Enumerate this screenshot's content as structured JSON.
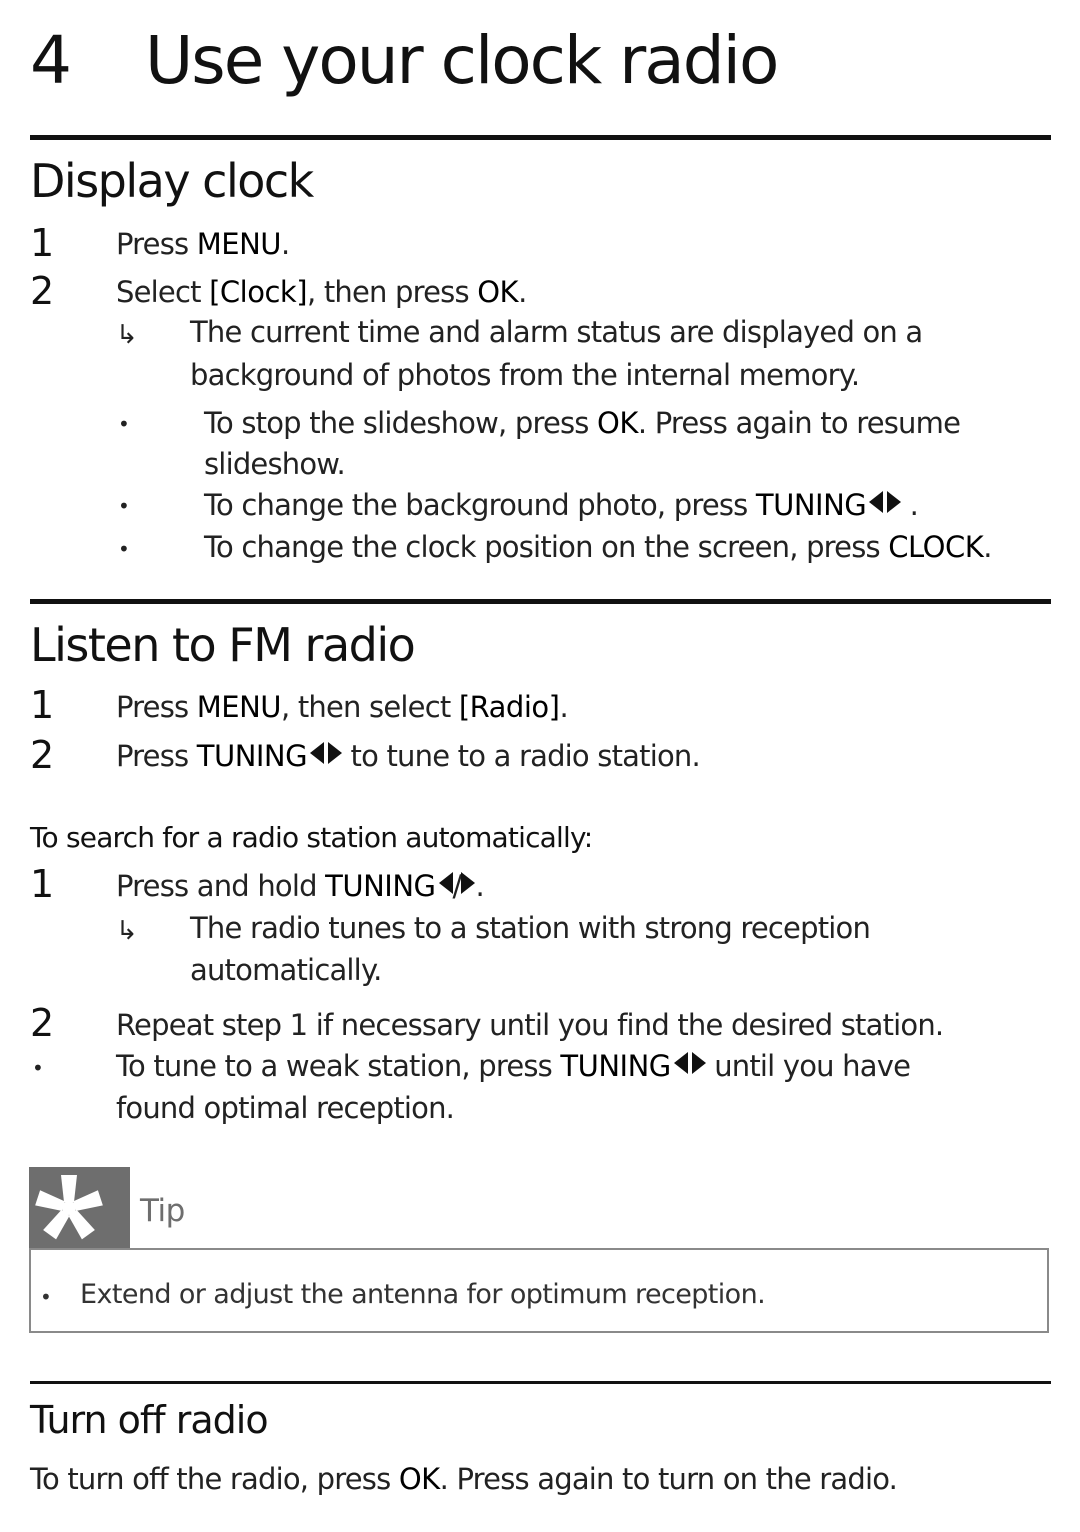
{
  "chapter": {
    "number": "4",
    "title": "Use your clock radio"
  },
  "display_clock": {
    "title": "Display clock",
    "steps": [
      {
        "num": "1",
        "pre": "Press ",
        "key": "MENU",
        "post": "."
      },
      {
        "num": "2",
        "pre": "Select ",
        "key": "[Clock]",
        "mid": ", then press ",
        "key2": "OK",
        "post": "."
      }
    ],
    "result": {
      "line1": "The current time and alarm status are displayed on a",
      "line2": "background of photos from the internal memory."
    },
    "bullets": [
      {
        "pre": "To stop the slideshow, press ",
        "key": "OK",
        "post": ". Press again to resume",
        "line2": "slideshow."
      },
      {
        "pre": "To change the background photo, press ",
        "key": "TUNING",
        "post": " ."
      },
      {
        "pre": "To change the clock position on the screen, press ",
        "key": "CLOCK",
        "post": "."
      }
    ]
  },
  "fm_radio": {
    "title": "Listen to FM radio",
    "steps": [
      {
        "num": "1",
        "pre": "Press ",
        "key": "MENU",
        "mid": ", then select ",
        "key2": "[Radio]",
        "post": "."
      },
      {
        "num": "2",
        "pre": "Press ",
        "key": "TUNING",
        "post": " to tune to a radio station."
      }
    ],
    "auto_search": {
      "heading": "To search for a radio station automatically:",
      "step1": {
        "num": "1",
        "pre": "Press and hold ",
        "key": "TUNING",
        "sep": "/",
        "post": "."
      },
      "result": {
        "line1": "The radio tunes to a station with strong reception",
        "line2": "automatically."
      },
      "step2": {
        "num": "2",
        "text": "Repeat step 1 if necessary until you find the desired station."
      },
      "bullet": {
        "pre": "To tune to a weak station, press ",
        "key": "TUNING",
        "post": " until you have",
        "line2": "found optimal reception."
      }
    }
  },
  "tip": {
    "label": "Tip",
    "icon": "asterisk-tip-icon",
    "items": [
      "Extend or adjust the antenna for optimum reception."
    ]
  },
  "turn_off": {
    "title": "Turn off radio",
    "pre": "To turn off the radio, press ",
    "key": "OK",
    "post": ". Press again to turn on the radio."
  },
  "glyphs": {
    "arrow": "↳",
    "bullet": "•"
  },
  "colors": {
    "text": "#111111",
    "tip_gray": "#6e6e6e",
    "tip_border": "#8a8a8a"
  }
}
